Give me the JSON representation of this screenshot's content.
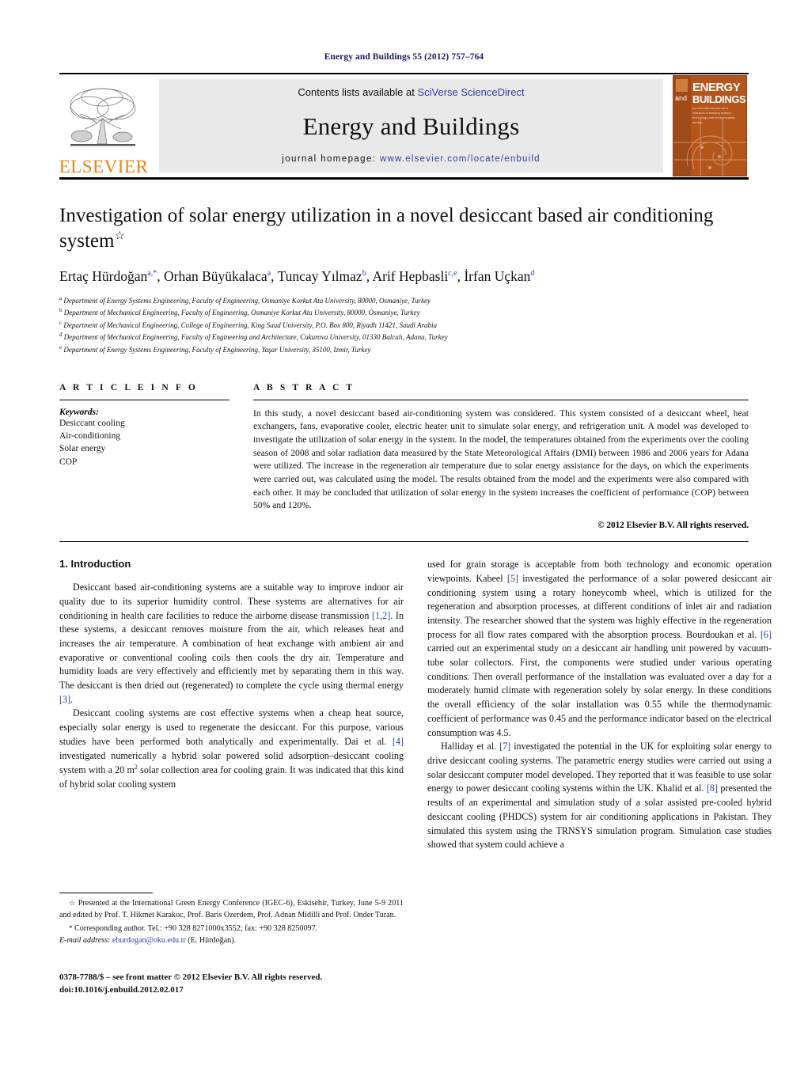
{
  "running_head": "Energy and Buildings 55 (2012) 757–764",
  "masthead": {
    "publisher_logo_text": "ELSEVIER",
    "contents_prefix": "Contents lists available at ",
    "contents_link": "SciVerse ScienceDirect",
    "journal_title": "Energy and Buildings",
    "homepage_label": "journal homepage:",
    "homepage_url": "www.elsevier.com/locate/enbuild",
    "cover": {
      "line1": "ENERGY",
      "line2": "BUILDINGS",
      "and": "and",
      "subtitle": "An international journal of research in building science, technology and environmental studies"
    }
  },
  "article": {
    "title": "Investigation of solar energy utilization in a novel desiccant based air conditioning system",
    "title_footnote_marker": "☆",
    "authors_html": "Ertaç Hürdoğan<sup>a,*</sup>, Orhan Büyükalaca<sup>a</sup>, Tuncay Yılmaz<sup>b</sup>, Arif Hepbasli<sup>c,e</sup>, İrfan Uçkan<sup>d</sup>",
    "affiliations": [
      {
        "marker": "a",
        "text": "Department of Energy Systems Engineering, Faculty of Engineering, Osmaniye Korkut Ata University, 80000, Osmaniye, Turkey"
      },
      {
        "marker": "b",
        "text": "Department of Mechanical Engineering, Faculty of Engineering, Osmaniye Korkut Ata University, 80000, Osmaniye, Turkey"
      },
      {
        "marker": "c",
        "text": "Department of Mechanical Engineering, College of Engineering, King Saud University, P.O. Box 800, Riyadh 11421, Saudi Arabia"
      },
      {
        "marker": "d",
        "text": "Department of Mechanical Engineering, Faculty of Engineering and Architecture, Cukurova University, 01330 Balcalı, Adana, Turkey"
      },
      {
        "marker": "e",
        "text": "Department of Energy Systems Engineering, Faculty of Engineering, Yaşar University, 35100, Izmir, Turkey"
      }
    ]
  },
  "article_info": {
    "heading": "A R T I C L E    I N F O",
    "keywords_label": "Keywords:",
    "keywords": [
      "Desiccant cooling",
      "Air-conditioning",
      "Solar energy",
      "COP"
    ]
  },
  "abstract": {
    "heading": "A B S T R A C T",
    "text": "In this study, a novel desiccant based air-conditioning system was considered. This system consisted of a desiccant wheel, heat exchangers, fans, evaporative cooler, electric heater unit to simulate solar energy, and refrigeration unit. A model was developed to investigate the utilization of solar energy in the system. In the model, the temperatures obtained from the experiments over the cooling season of 2008 and solar radiation data measured by the State Meteorological Affairs (DMI) between 1986 and 2006 years for Adana were utilized. The increase in the regeneration air temperature due to solar energy assistance for the days, on which the experiments were carried out, was calculated using the model. The results obtained from the model and the experiments were also compared with each other. It may be concluded that utilization of solar energy in the system increases the coefficient of performance (COP) between 50% and 120%.",
    "copyright": "© 2012 Elsevier B.V. All rights reserved."
  },
  "introduction": {
    "heading": "1.  Introduction",
    "left_paragraphs": [
      "Desiccant based air-conditioning systems are a suitable way to improve indoor air quality due to its superior humidity control. These systems are alternatives for air conditioning in health care facilities to reduce the airborne disease transmission [1,2]. In these systems, a desiccant removes moisture from the air, which releases heat and increases the air temperature. A combination of heat exchange with ambient air and evaporative or conventional cooling coils then cools the dry air. Temperature and humidity loads are very effectively and efficiently met by separating them in this way. The desiccant is then dried out (regenerated) to complete the cycle using thermal energy [3].",
      "Desiccant cooling systems are cost effective systems when a cheap heat source, especially solar energy is used to regenerate the desiccant. For this purpose, various studies have been performed both analytically and experimentally. Dai et al. [4] investigated numerically a hybrid solar powered solid adsorption–desiccant cooling system with a 20 m2 solar collection area for cooling grain. It was indicated that this kind of hybrid solar cooling system"
    ],
    "right_paragraphs": [
      "used for grain storage is acceptable from both technology and economic operation viewpoints. Kabeel [5] investigated the performance of a solar powered desiccant air conditioning system using a rotary honeycomb wheel, which is utilized for the regeneration and absorption processes, at different conditions of inlet air and radiation intensity. The researcher showed that the system was highly effective in the regeneration process for all flow rates compared with the absorption process. Bourdoukan et al. [6] carried out an experimental study on a desiccant air handling unit powered by vacuum-tube solar collectors. First, the components were studied under various operating conditions. Then overall performance of the installation was evaluated over a day for a moderately humid climate with regeneration solely by solar energy. In these conditions the overall efficiency of the solar installation was 0.55 while the thermodynamic coefficient of performance was 0.45 and the performance indicator based on the electrical consumption was 4.5.",
      "Halliday et al. [7] investigated the potential in the UK for exploiting solar energy to drive desiccant cooling systems. The parametric energy studies were carried out using a solar desiccant computer model developed. They reported that it was feasible to use solar energy to power desiccant cooling systems within the UK. Khalid et al. [8] presented the results of an experimental and simulation study of a solar assisted pre-cooled hybrid desiccant cooling (PHDCS) system for air conditioning applications in Pakistan. They simulated this system using the TRNSYS simulation program. Simulation case studies showed that system could achieve a"
    ]
  },
  "footnotes": {
    "star_marker": "☆",
    "star_text": "Presented at the International Green Energy Conference (IGEC-6), Eskisehir, Turkey, June 5-9 2011 and edited by Prof. T. Hikmet Karakoc, Prof. Baris Ozerdem, Prof. Adnan Midilli and Prof. Onder Turan.",
    "corr_marker": "*",
    "corr_text": "Corresponding author. Tel.: +90 328 8271000x3552; fax: +90 328 8250097.",
    "email_label": "E-mail address:",
    "email": "ehurdogan@oku.edu.tr",
    "email_owner": "(E. Hürdoğan)."
  },
  "imprint": {
    "issn_line": "0378-7788/$ – see front matter © 2012 Elsevier B.V. All rights reserved.",
    "doi_line": "doi:10.1016/j.enbuild.2012.02.017"
  },
  "colors": {
    "link_blue": "#2b3fa0",
    "elsevier_orange": "#f08010",
    "cover_rust": "#b4551c"
  }
}
